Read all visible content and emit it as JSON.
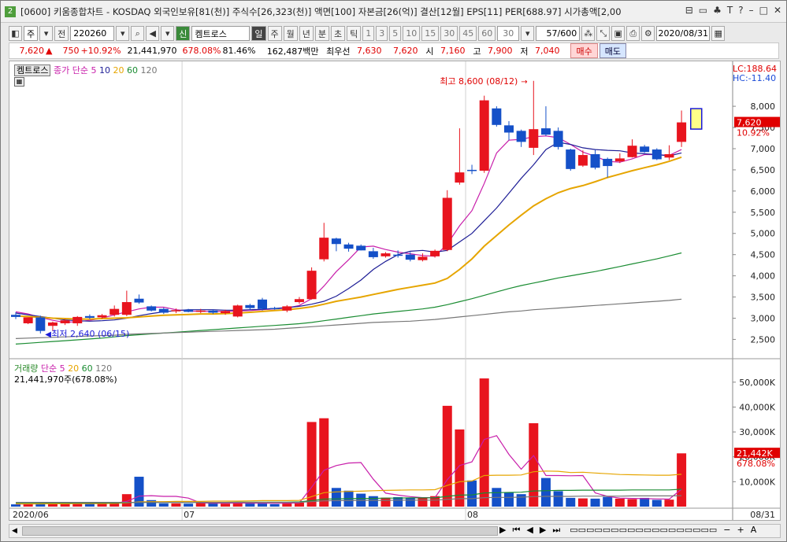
{
  "window": {
    "number": "2",
    "title": "[0600] 키움종합차트 - KOSDAQ 외국인보유[81(천)] 주식수[26,323(천)] 액면[100] 자본금[26(억)] 결산[12월] EPS[11] PER[688.97] 시가총액[2,00",
    "buttons": [
      "⊟",
      "▭",
      "♣",
      "T",
      "?",
      "–",
      "□",
      "✕"
    ]
  },
  "toolbar": {
    "period": "주",
    "prev": "전",
    "code": "220260",
    "credit": "신",
    "name": "켐트로스",
    "units": [
      "일",
      "주",
      "월",
      "년",
      "분",
      "초",
      "틱"
    ],
    "intervals": [
      "1",
      "3",
      "5",
      "10",
      "15",
      "30",
      "45",
      "60"
    ],
    "interval_value": "30",
    "count": "57/600",
    "date": "2020/08/31"
  },
  "quote": {
    "price": "7,620",
    "arrow": "▲",
    "change": "750",
    "change_pct": "+10.92%",
    "volume": "21,441,970",
    "volume_pct": "678.08%",
    "ratio": "81.46%",
    "amount": "162,487백만",
    "best_label": "최우선",
    "ask": "7,630",
    "bid": "7,620",
    "open_label": "시",
    "open": "7,160",
    "high_label": "고",
    "high": "7,900",
    "low_label": "저",
    "low": "7,040",
    "buy": "매수",
    "sell": "매도"
  },
  "price_legend": {
    "name": "켐트로스",
    "ma_label": "종가 단순",
    "ma": [
      {
        "label": "5",
        "color": "#c81eaa"
      },
      {
        "label": "10",
        "color": "#1e1e96"
      },
      {
        "label": "20",
        "color": "#e6a500"
      },
      {
        "label": "60",
        "color": "#1a8c32"
      },
      {
        "label": "120",
        "color": "#777777"
      }
    ],
    "lc": "LC:188.64",
    "hc": "HC:-11.40",
    "max_label": "최고 8,600 (08/12)",
    "min_label": "최저 2,640 (06/15)",
    "cur_price": "7,620",
    "cur_pct": "10.92%"
  },
  "volume_legend": {
    "title": "거래량",
    "ma_label": "단순",
    "ma": [
      {
        "label": "5",
        "color": "#c81eaa"
      },
      {
        "label": "20",
        "color": "#e6a500"
      },
      {
        "label": "60",
        "color": "#1a8c32"
      },
      {
        "label": "120",
        "color": "#777777"
      }
    ],
    "current": "21,441,970주(678.08%)",
    "cur_value": "21,442K",
    "cur_pct": "678.08%"
  },
  "price_axis": [
    "8,000",
    "7,500",
    "7,000",
    "6,500",
    "6,000",
    "5,500",
    "5,000",
    "4,500",
    "4,000",
    "3,500",
    "3,000",
    "2,500"
  ],
  "volume_axis": [
    "50,000K",
    "40,000K",
    "30,000K",
    "20,000K",
    "10,000K"
  ],
  "date_axis": [
    "2020/06",
    "07",
    "08",
    "08/31"
  ],
  "chart_data": {
    "type": "candlestick",
    "price_range": [
      2100,
      8800
    ],
    "volume_range": [
      0,
      55000
    ],
    "candles": [
      {
        "o": 3080,
        "h": 3140,
        "l": 2980,
        "c": 3030
      },
      {
        "o": 2880,
        "h": 3020,
        "l": 2860,
        "c": 3020
      },
      {
        "o": 3020,
        "h": 3060,
        "l": 2640,
        "c": 2700
      },
      {
        "o": 2820,
        "h": 2920,
        "l": 2700,
        "c": 2900
      },
      {
        "o": 2880,
        "h": 2980,
        "l": 2840,
        "c": 2950
      },
      {
        "o": 2880,
        "h": 3050,
        "l": 2820,
        "c": 3030
      },
      {
        "o": 3050,
        "h": 3090,
        "l": 2980,
        "c": 3010
      },
      {
        "o": 3020,
        "h": 3100,
        "l": 2990,
        "c": 3070
      },
      {
        "o": 3080,
        "h": 3300,
        "l": 3040,
        "c": 3220
      },
      {
        "o": 3080,
        "h": 3650,
        "l": 3050,
        "c": 3380
      },
      {
        "o": 3460,
        "h": 3560,
        "l": 3340,
        "c": 3370
      },
      {
        "o": 3280,
        "h": 3300,
        "l": 3160,
        "c": 3180
      },
      {
        "o": 3220,
        "h": 3250,
        "l": 3100,
        "c": 3130
      },
      {
        "o": 3180,
        "h": 3230,
        "l": 3120,
        "c": 3190
      },
      {
        "o": 3200,
        "h": 3220,
        "l": 3140,
        "c": 3150
      },
      {
        "o": 3170,
        "h": 3220,
        "l": 3120,
        "c": 3180
      },
      {
        "o": 3180,
        "h": 3210,
        "l": 3100,
        "c": 3130
      },
      {
        "o": 3120,
        "h": 3200,
        "l": 3080,
        "c": 3170
      },
      {
        "o": 3040,
        "h": 3320,
        "l": 3020,
        "c": 3300
      },
      {
        "o": 3310,
        "h": 3340,
        "l": 3200,
        "c": 3240
      },
      {
        "o": 3440,
        "h": 3480,
        "l": 3180,
        "c": 3220
      },
      {
        "o": 3240,
        "h": 3270,
        "l": 3200,
        "c": 3220
      },
      {
        "o": 3180,
        "h": 3310,
        "l": 3140,
        "c": 3280
      },
      {
        "o": 3380,
        "h": 3500,
        "l": 3340,
        "c": 3450
      },
      {
        "o": 3450,
        "h": 4200,
        "l": 3440,
        "c": 4120
      },
      {
        "o": 4390,
        "h": 5250,
        "l": 4340,
        "c": 4900
      },
      {
        "o": 4880,
        "h": 4900,
        "l": 4580,
        "c": 4750
      },
      {
        "o": 4740,
        "h": 4780,
        "l": 4570,
        "c": 4640
      },
      {
        "o": 4710,
        "h": 4740,
        "l": 4600,
        "c": 4600
      },
      {
        "o": 4580,
        "h": 4660,
        "l": 4400,
        "c": 4440
      },
      {
        "o": 4460,
        "h": 4560,
        "l": 4430,
        "c": 4530
      },
      {
        "o": 4500,
        "h": 4600,
        "l": 4430,
        "c": 4480
      },
      {
        "o": 4500,
        "h": 4560,
        "l": 4340,
        "c": 4380
      },
      {
        "o": 4370,
        "h": 4530,
        "l": 4340,
        "c": 4450
      },
      {
        "o": 4460,
        "h": 4620,
        "l": 4430,
        "c": 4590
      },
      {
        "o": 4610,
        "h": 6020,
        "l": 4580,
        "c": 5840
      },
      {
        "o": 6200,
        "h": 7480,
        "l": 6150,
        "c": 6440
      },
      {
        "o": 6500,
        "h": 6620,
        "l": 6400,
        "c": 6480
      },
      {
        "o": 6480,
        "h": 8250,
        "l": 6430,
        "c": 8140
      },
      {
        "o": 7950,
        "h": 8000,
        "l": 7520,
        "c": 7560
      },
      {
        "o": 7550,
        "h": 7650,
        "l": 7200,
        "c": 7380
      },
      {
        "o": 7420,
        "h": 7450,
        "l": 7040,
        "c": 7160
      },
      {
        "o": 7020,
        "h": 8600,
        "l": 6850,
        "c": 7460
      },
      {
        "o": 7480,
        "h": 8000,
        "l": 7300,
        "c": 7330
      },
      {
        "o": 7420,
        "h": 7500,
        "l": 6980,
        "c": 7040
      },
      {
        "o": 6980,
        "h": 7000,
        "l": 6480,
        "c": 6520
      },
      {
        "o": 6600,
        "h": 6960,
        "l": 6570,
        "c": 6850
      },
      {
        "o": 6870,
        "h": 6980,
        "l": 6510,
        "c": 6550
      },
      {
        "o": 6760,
        "h": 6790,
        "l": 6320,
        "c": 6590
      },
      {
        "o": 6700,
        "h": 6890,
        "l": 6660,
        "c": 6770
      },
      {
        "o": 6800,
        "h": 7220,
        "l": 6790,
        "c": 7070
      },
      {
        "o": 7050,
        "h": 7090,
        "l": 6900,
        "c": 6920
      },
      {
        "o": 6980,
        "h": 7010,
        "l": 6730,
        "c": 6750
      },
      {
        "o": 6790,
        "h": 7080,
        "l": 6730,
        "c": 6870
      },
      {
        "o": 7160,
        "h": 7900,
        "l": 7040,
        "c": 7620
      }
    ],
    "volumes": [
      900,
      1000,
      1300,
      1200,
      1100,
      1500,
      1100,
      1200,
      1600,
      5000,
      12000,
      2600,
      1300,
      1300,
      1200,
      1500,
      1500,
      1200,
      1800,
      1300,
      1300,
      1000,
      1400,
      1600,
      34000,
      35500,
      7500,
      6400,
      5200,
      4200,
      3600,
      3800,
      3500,
      3400,
      4200,
      40500,
      31000,
      10500,
      51500,
      7500,
      5600,
      5000,
      33500,
      11500,
      6200,
      3500,
      3300,
      3200,
      3900,
      3200,
      3000,
      3500,
      2700,
      2800,
      21400
    ],
    "ma_price": [
      {
        "name": "5",
        "points": [
          3150,
          3100,
          3020,
          2950,
          2900,
          2920,
          2950,
          3000,
          3080,
          3150,
          3220,
          3260,
          3260,
          3200,
          3170,
          3160,
          3160,
          3160,
          3170,
          3180,
          3200,
          3220,
          3240,
          3300,
          3460,
          3760,
          4100,
          4380,
          4680,
          4700,
          4620,
          4560,
          4520,
          4480,
          4460,
          4750,
          5180,
          5540,
          6180,
          6900,
          7200,
          7220,
          7280,
          7300,
          7260,
          7100,
          6920,
          6820,
          6700,
          6680,
          6760,
          6860,
          6860,
          6840,
          6980
        ]
      },
      {
        "name": "10",
        "points": [
          3120,
          3080,
          3040,
          3000,
          2960,
          2940,
          2930,
          2940,
          2960,
          3000,
          3060,
          3110,
          3150,
          3180,
          3200,
          3200,
          3200,
          3190,
          3190,
          3200,
          3210,
          3230,
          3250,
          3280,
          3330,
          3400,
          3520,
          3700,
          3900,
          4150,
          4340,
          4500,
          4580,
          4600,
          4560,
          4600,
          4800,
          5000,
          5300,
          5600,
          5950,
          6300,
          6620,
          6980,
          7150,
          7100,
          7020,
          6980,
          6960,
          6950,
          6900,
          6880,
          6860,
          6830,
          6900
        ]
      },
      {
        "name": "20",
        "points": [
          3050,
          3040,
          3020,
          3000,
          2990,
          2980,
          2980,
          2990,
          3000,
          3010,
          3030,
          3050,
          3070,
          3080,
          3090,
          3100,
          3100,
          3110,
          3120,
          3140,
          3160,
          3180,
          3200,
          3230,
          3270,
          3330,
          3400,
          3450,
          3500,
          3560,
          3620,
          3680,
          3730,
          3780,
          3830,
          3940,
          4150,
          4400,
          4700,
          4950,
          5200,
          5430,
          5650,
          5820,
          5960,
          6060,
          6130,
          6220,
          6320,
          6400,
          6480,
          6550,
          6620,
          6700,
          6800
        ]
      },
      {
        "name": "60",
        "points": [
          2390,
          2410,
          2430,
          2450,
          2470,
          2490,
          2510,
          2530,
          2560,
          2590,
          2610,
          2630,
          2650,
          2670,
          2690,
          2710,
          2730,
          2750,
          2770,
          2790,
          2810,
          2830,
          2850,
          2870,
          2900,
          2940,
          2980,
          3020,
          3060,
          3100,
          3130,
          3160,
          3190,
          3220,
          3260,
          3320,
          3390,
          3460,
          3540,
          3620,
          3700,
          3770,
          3830,
          3890,
          3950,
          4000,
          4050,
          4100,
          4160,
          4220,
          4280,
          4340,
          4400,
          4470,
          4540
        ]
      },
      {
        "name": "120",
        "points": [
          2520,
          2530,
          2540,
          2550,
          2560,
          2570,
          2580,
          2590,
          2600,
          2620,
          2630,
          2640,
          2650,
          2660,
          2670,
          2680,
          2690,
          2700,
          2710,
          2720,
          2730,
          2740,
          2760,
          2780,
          2800,
          2820,
          2840,
          2860,
          2880,
          2900,
          2910,
          2920,
          2930,
          2950,
          2970,
          3000,
          3030,
          3060,
          3090,
          3120,
          3150,
          3170,
          3200,
          3220,
          3240,
          3260,
          3280,
          3300,
          3320,
          3340,
          3360,
          3380,
          3400,
          3420,
          3450
        ]
      }
    ],
    "ma_volume": [
      {
        "name": "5",
        "points": [
          1000,
          1050,
          1150,
          1180,
          1200,
          1240,
          1240,
          1280,
          1300,
          2100,
          4200,
          4400,
          4100,
          4100,
          3400,
          1500,
          1380,
          1320,
          1440,
          1400,
          1360,
          1340,
          1400,
          1440,
          7800,
          14600,
          16500,
          17500,
          17700,
          11000,
          5400,
          4600,
          4000,
          3600,
          3600,
          10800,
          16500,
          18000,
          27000,
          28500,
          21000,
          15000,
          20500,
          12500,
          12500,
          12400,
          12500,
          5500,
          4100,
          3400,
          3300,
          3200,
          3100,
          3000,
          7000
        ]
      },
      {
        "name": "20",
        "points": [
          1100,
          1100,
          1100,
          1150,
          1150,
          1200,
          1200,
          1200,
          1300,
          1500,
          1900,
          2000,
          2000,
          2100,
          2100,
          2100,
          2200,
          2200,
          2200,
          2300,
          2400,
          2400,
          2400,
          2500,
          4000,
          5600,
          5900,
          6100,
          6200,
          6400,
          6500,
          6600,
          6700,
          6700,
          6800,
          8500,
          10000,
          10300,
          12500,
          12600,
          12600,
          12700,
          14000,
          14300,
          14200,
          13700,
          13800,
          13500,
          13200,
          12900,
          12800,
          12700,
          12600,
          12600,
          13000
        ]
      },
      {
        "name": "60",
        "points": [
          1500,
          1500,
          1500,
          1500,
          1500,
          1500,
          1500,
          1500,
          1500,
          1600,
          1700,
          1700,
          1700,
          1700,
          1700,
          1700,
          1700,
          1700,
          1800,
          1800,
          1800,
          1800,
          1800,
          1900,
          2400,
          3000,
          3100,
          3200,
          3300,
          3300,
          3400,
          3400,
          3500,
          3500,
          3500,
          4100,
          4600,
          4700,
          5500,
          5600,
          5700,
          5800,
          6300,
          6400,
          6500,
          6500,
          6600,
          6600,
          6600,
          6600,
          6700,
          6700,
          6700,
          6700,
          7000
        ]
      },
      {
        "name": "120",
        "points": [
          1700,
          1700,
          1700,
          1700,
          1700,
          1700,
          1700,
          1700,
          1700,
          1700,
          1700,
          1700,
          1700,
          1700,
          1700,
          1700,
          1700,
          1700,
          1700,
          1700,
          1700,
          1700,
          1700,
          1700,
          2000,
          2300,
          2400,
          2400,
          2500,
          2500,
          2500,
          2600,
          2600,
          2600,
          2600,
          2900,
          3200,
          3200,
          3600,
          3700,
          3700,
          3800,
          4000,
          4100,
          4100,
          4100,
          4200,
          4200,
          4200,
          4200,
          4300,
          4300,
          4300,
          4300,
          4400
        ]
      }
    ]
  }
}
